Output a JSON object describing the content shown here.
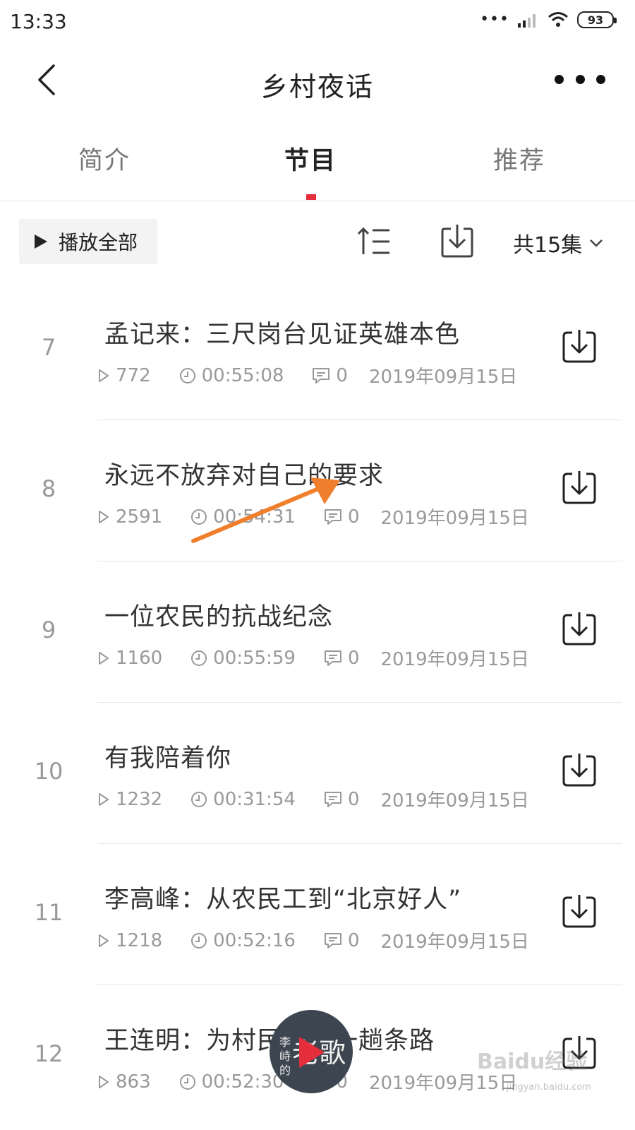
{
  "status_bar": {
    "time": "13:33",
    "battery": "93"
  },
  "nav": {
    "title": "乡村夜话"
  },
  "tabs": [
    {
      "label": "简介"
    },
    {
      "label": "节目"
    },
    {
      "label": "推荐"
    }
  ],
  "toolbar": {
    "play_all_label": "播放全部",
    "count_label": "共15集"
  },
  "episodes": [
    {
      "index": "7",
      "title": "孟记来：三尺岗台见证英雄本色",
      "plays": "772",
      "duration": "00:55:08",
      "comments": "0",
      "date": "2019年09月15日"
    },
    {
      "index": "8",
      "title": "永远不放弃对自己的要求",
      "plays": "2591",
      "duration": "00:54:31",
      "comments": "0",
      "date": "2019年09月15日"
    },
    {
      "index": "9",
      "title": "一位农民的抗战纪念",
      "plays": "1160",
      "duration": "00:55:59",
      "comments": "0",
      "date": "2019年09月15日"
    },
    {
      "index": "10",
      "title": "有我陪着你",
      "plays": "1232",
      "duration": "00:31:54",
      "comments": "0",
      "date": "2019年09月15日"
    },
    {
      "index": "11",
      "title": "李高峰：从农民工到“北京好人”",
      "plays": "1218",
      "duration": "00:52:16",
      "comments": "0",
      "date": "2019年09月15日"
    },
    {
      "index": "12",
      "title": "王连明：为村民蹚出一趟条路",
      "plays": "863",
      "duration": "00:52:30",
      "comments": "0",
      "date": "2019年09月15日"
    }
  ],
  "mini_player": {
    "cover_left": "李峙的",
    "cover_right": "老歌"
  },
  "watermark": {
    "brand": "Baidu经验",
    "url": "jingyan.baidu.com"
  },
  "colors": {
    "accent": "#e52e3c",
    "annotation_arrow": "#f07f2d"
  }
}
